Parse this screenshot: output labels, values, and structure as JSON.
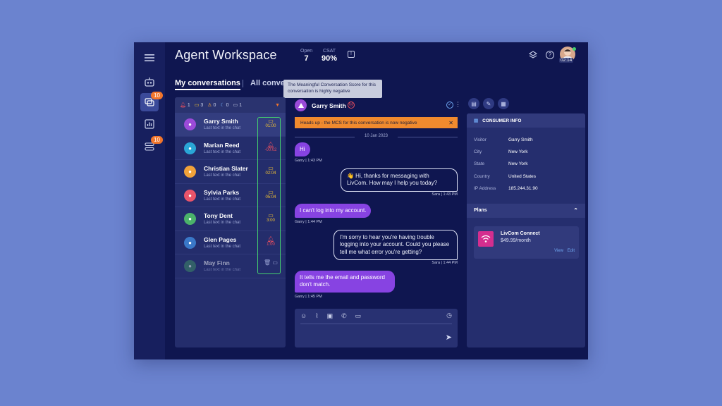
{
  "app": {
    "title": "Agent Workspace",
    "kpis": [
      {
        "label": "Open",
        "value": "7"
      },
      {
        "label": "CSAT",
        "value": "90%"
      }
    ],
    "timer": "02:14",
    "chat_badge": "10",
    "queue_badge": "10"
  },
  "tabs": {
    "active": "My conversations",
    "other": "All conve"
  },
  "tooltip": "The Meaningful Conversation Score for this conversation is highly negative",
  "filters": [
    "1",
    "3",
    "0",
    "0",
    "1"
  ],
  "conversations": [
    {
      "name": "Garry Smith",
      "preview": "Last text in the chat",
      "time": "01:00",
      "color": "#9b4bd8",
      "status": "chat",
      "meta_color": "#f2c232"
    },
    {
      "name": "Marian Reed",
      "preview": "Last text in the chat",
      "time": "-00:02",
      "color": "#2aa6d6",
      "status": "alert",
      "meta_color": "#ea4f5f"
    },
    {
      "name": "Christian Slater",
      "preview": "Last text in the chat",
      "time": "02:04",
      "color": "#f1a23a",
      "status": "chat",
      "meta_color": "#f2c232"
    },
    {
      "name": "Sylvia Parks",
      "preview": "Last text in the chat",
      "time": "05:04",
      "color": "#e9546a",
      "status": "chat",
      "meta_color": "#f2c232"
    },
    {
      "name": "Tony Dent",
      "preview": "Last text in the chat",
      "time": "3:00",
      "color": "#4bb26a",
      "status": "chat",
      "meta_color": "#f2c232"
    },
    {
      "name": "Glen Pages",
      "preview": "Last text in the chat",
      "time": "1:00",
      "color": "#3a78c8",
      "status": "alert",
      "meta_color": "#ea4f5f"
    },
    {
      "name": "May Finn",
      "preview": "Last text in the chat",
      "time": "",
      "color": "#3f8a66",
      "status": "done",
      "meta_color": "#9aa4d4"
    }
  ],
  "chat": {
    "contact": "Garry Smith",
    "alert": "Heads up - the MCS for this conversation is now negative",
    "date": "10 Jan 2023",
    "messages": [
      {
        "dir": "in",
        "text": "Hi",
        "meta": "Garry  |  1:43 PM"
      },
      {
        "dir": "out",
        "text": "👋 Hi, thanks for messaging with LivCom. How may I help you today?",
        "meta": "Sara  |  1:43 PM"
      },
      {
        "dir": "in",
        "text": "I can't log into my account.",
        "meta": "Garry  |  1:44 PM"
      },
      {
        "dir": "out",
        "text": "I'm sorry to hear you're having trouble logging into your account. Could you please tell me what error you're getting?",
        "meta": "Sara  |  1:44 PM"
      },
      {
        "dir": "in",
        "text": "It tells me the email and password don't match.",
        "meta": "Garry  |  1:45 PM"
      }
    ]
  },
  "consumer": {
    "header": "CONSUMER INFO",
    "fields": [
      {
        "label": "Visitor",
        "value": "Garry Smith"
      },
      {
        "label": "City",
        "value": "New York"
      },
      {
        "label": "State",
        "value": "New York"
      },
      {
        "label": "Country",
        "value": "United States"
      },
      {
        "label": "IP Address",
        "value": "185.244.31.90"
      }
    ],
    "plans_header": "Plans",
    "plan": {
      "name": "LivCom Connect",
      "price": "$49.99/month",
      "view": "View",
      "edit": "Edit"
    }
  },
  "colors": {
    "accent": "#8743e2",
    "alert": "#f08a2e",
    "highlight": "#44d06f",
    "badge": "#f2752b"
  }
}
